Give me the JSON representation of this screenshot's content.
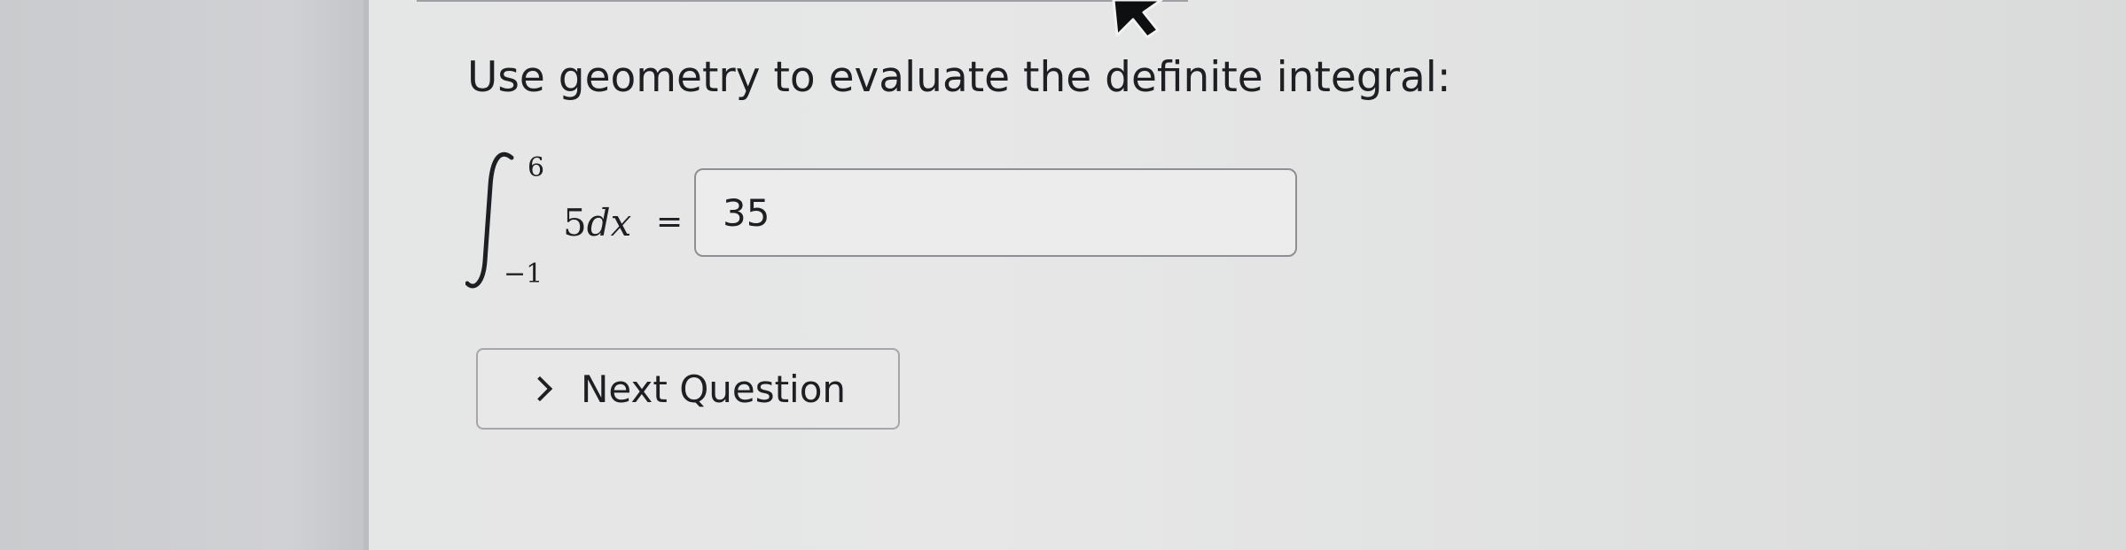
{
  "question": {
    "prompt": "Use geometry to evaluate the definite integral:",
    "integral": {
      "upper_limit": "6",
      "lower_limit": "−1",
      "coefficient": "5",
      "differential": "dx",
      "equals": "="
    }
  },
  "answer_input": {
    "value": "35"
  },
  "next_button": {
    "label": "Next Question",
    "icon": "chevron-right-icon"
  },
  "colors": {
    "panel_background": "#e6e6e6",
    "text": "#1d1f22",
    "input_border": "#8d8f92",
    "button_border": "#a4a6a9"
  }
}
